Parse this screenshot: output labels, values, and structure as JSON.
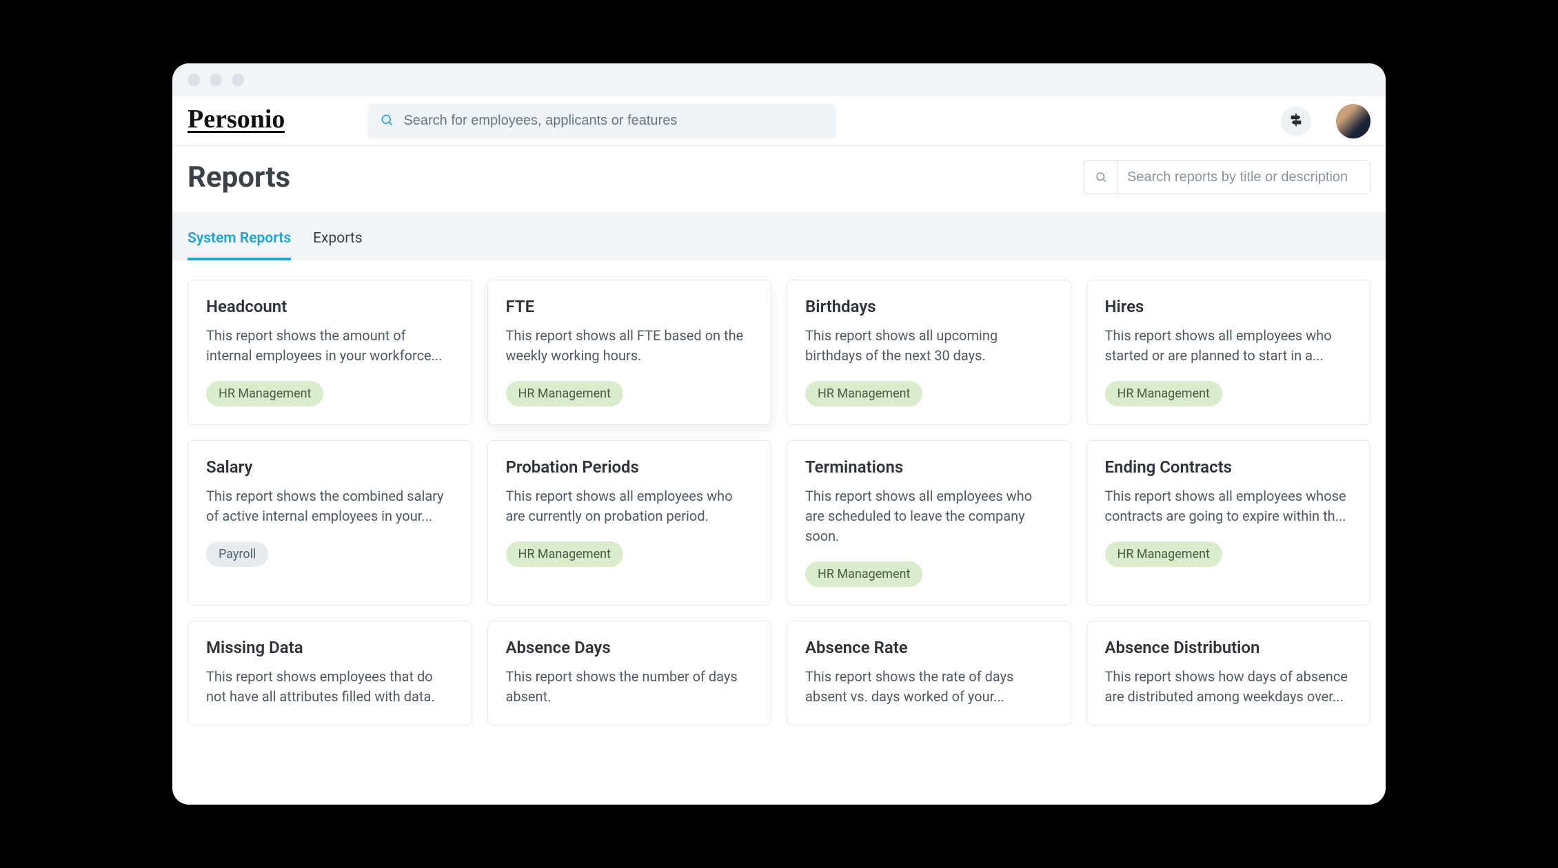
{
  "brand": "Personio",
  "search": {
    "global_placeholder": "Search for employees, applicants or features",
    "reports_placeholder": "Search reports by title or description"
  },
  "page": {
    "title": "Reports"
  },
  "tabs": [
    {
      "label": "System Reports",
      "active": true
    },
    {
      "label": "Exports",
      "active": false
    }
  ],
  "tags": {
    "hr": "HR Management",
    "payroll": "Payroll"
  },
  "reports": [
    {
      "title": "Headcount",
      "desc": "This report shows the amount of internal employees in your workforce...",
      "tag": "hr"
    },
    {
      "title": "FTE",
      "desc": "This report shows all FTE based on the weekly working hours.",
      "tag": "hr",
      "elevated": true
    },
    {
      "title": "Birthdays",
      "desc": "This report shows all upcoming birthdays of the next 30 days.",
      "tag": "hr"
    },
    {
      "title": "Hires",
      "desc": "This report shows all employees who started or are planned to start in a...",
      "tag": "hr"
    },
    {
      "title": "Salary",
      "desc": "This report shows the combined salary of active internal employees in your...",
      "tag": "payroll"
    },
    {
      "title": "Probation Periods",
      "desc": "This report shows all employees who are currently on probation period.",
      "tag": "hr"
    },
    {
      "title": "Terminations",
      "desc": "This report shows all employees who are scheduled to leave the company soon.",
      "tag": "hr"
    },
    {
      "title": "Ending Contracts",
      "desc": "This report shows all employees whose contracts are going to expire within th...",
      "tag": "hr"
    },
    {
      "title": "Missing Data",
      "desc": "This report shows employees that do not have all attributes filled with data.",
      "tag": "hr"
    },
    {
      "title": "Absence Days",
      "desc": "This report shows the number of days absent.",
      "tag": "hr"
    },
    {
      "title": "Absence Rate",
      "desc": "This report shows the rate of days absent vs. days worked of your...",
      "tag": "hr"
    },
    {
      "title": "Absence Distribution",
      "desc": "This report shows how days of absence are distributed among weekdays over...",
      "tag": "hr"
    }
  ]
}
